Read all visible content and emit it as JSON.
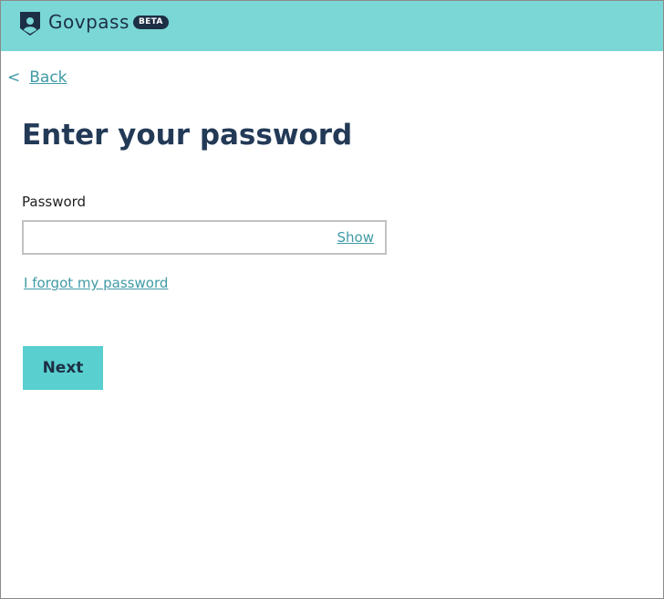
{
  "header": {
    "brand_name": "Govpass",
    "badge": "BETA",
    "logo_icon": "shield-person-icon",
    "background_color": "#7ad7d6"
  },
  "nav": {
    "back_chevron": "<",
    "back_label": "Back"
  },
  "main": {
    "title": "Enter your password",
    "password_label": "Password",
    "password_value": "",
    "show_label": "Show",
    "forgot_link": "I forgot my password",
    "next_label": "Next"
  },
  "colors": {
    "accent": "#59cfcf",
    "link": "#3f9aa5",
    "heading": "#233a57"
  }
}
